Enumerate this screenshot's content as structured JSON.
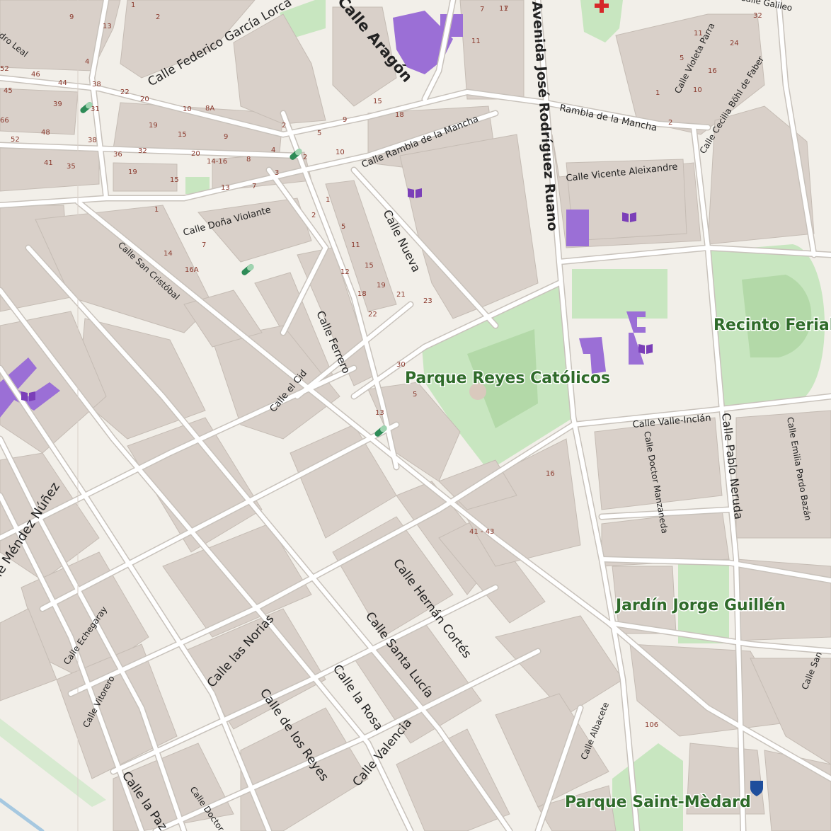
{
  "colors": {
    "background": "#f2efe9",
    "building": "#d9d0c9",
    "road": "#ffffff",
    "road_casing": "#c8c2bb",
    "park": "#c8e6c0",
    "park_inner": "#b3d9a8",
    "school": "#9b6fd6",
    "park_label": "#2f6b2a",
    "house_number": "#8b3a2e",
    "pharmacy": "#2e8b57",
    "hospital": "#d62828",
    "police": "#1f4e9c"
  },
  "streets": {
    "federico_garcia_lorca": "Calle Federico García Lorca",
    "aragon": "Calle Aragón",
    "avenida_jose": "Avenida José Rodríguez Ruano",
    "rambla": "Rambla de la Mancha",
    "calle_rambla": "Calle Rambla de la Mancha",
    "vicente_aleixandre": "Calle Vicente Aleixandre",
    "violeta_parra": "Calle Violeta Parra",
    "cecilia": "Calle Cecilia Böhl de Faber",
    "galileo": "Calle Galileo",
    "pedro_leal": "Calle Pedro Leal",
    "dona_violante": "Calle Doña Violante",
    "san_cristobal": "Calle San Cristóbal",
    "nueva": "Calle Nueva",
    "ferrero": "Calle Ferrero",
    "el_cid": "Calle el Cid",
    "mendez_nunez": "Calle Méndez Núñez",
    "valle_inclan": "Calle Valle-Inclán",
    "doctor_manzaneda": "Calle Doctor Manzaneda",
    "pablo_neruda": "Calle Pablo Neruda",
    "emilia_pardo": "Calle Emilia Pardo Bazán",
    "hernan_cortes": "Calle Hernán Cortés",
    "santa_lucia": "Calle Santa Lucía",
    "las_norias": "Calle las Norias",
    "la_rosa": "Calle la Rosa",
    "de_los_reyes": "Calle de los Reyes",
    "valencia": "Calle Valencia",
    "echegaray": "Calle Echegaray",
    "vitorero": "Calle Vitorero",
    "la_paz": "Calle la Paz",
    "doctor": "Calle Doctor",
    "albacete": "Calle Albacete",
    "san": "Calle San"
  },
  "parks": {
    "reyes_catolicos": "Parque Reyes Católicos",
    "recinto_ferial": "Recinto Ferial",
    "jorge_guillen": "Jardín Jorge Guillén",
    "saint_medard": "Parque Saint-Mèdard"
  },
  "house_numbers": [
    "9",
    "13",
    "1",
    "2",
    "52",
    "46",
    "44",
    "38",
    "22",
    "20",
    "45",
    "39",
    "31",
    "4",
    "10",
    "8A",
    "66",
    "52",
    "48",
    "38",
    "36",
    "32",
    "19",
    "15",
    "9",
    "2",
    "5",
    "20",
    "14-16",
    "8",
    "4",
    "3",
    "2",
    "10",
    "41",
    "35",
    "19",
    "15",
    "13",
    "7",
    "1",
    "7",
    "11",
    "15",
    "18",
    "9",
    "1",
    "5",
    "11",
    "15",
    "19",
    "21",
    "23",
    "12",
    "18",
    "22",
    "30",
    "5",
    "13",
    "2",
    "14",
    "16A",
    "7",
    "16",
    "41 - 43",
    "106",
    "11",
    "5",
    "1",
    "24",
    "16",
    "10",
    "2",
    "32",
    "11",
    "7"
  ],
  "icons": [
    "school-icon",
    "pharmacy-icon",
    "hospital-icon",
    "police-icon"
  ]
}
